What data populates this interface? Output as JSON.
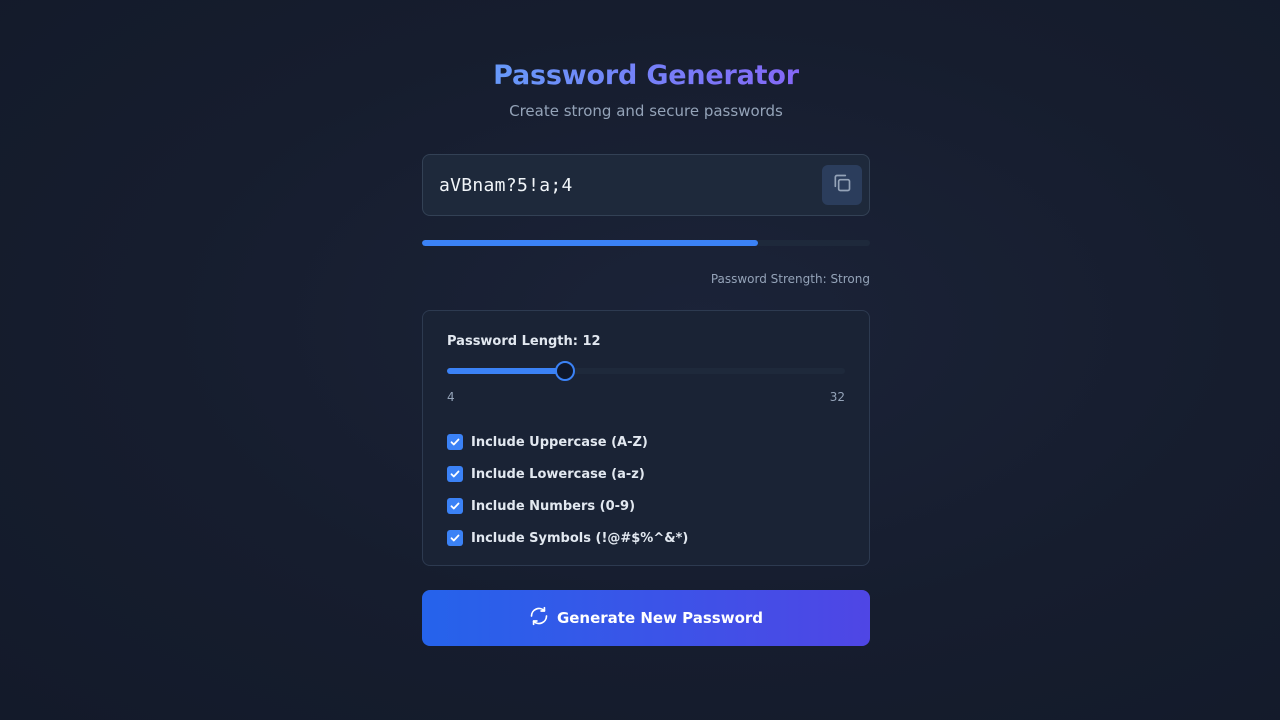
{
  "header": {
    "title": "Password Generator",
    "subtitle": "Create strong and secure passwords"
  },
  "password": {
    "value": "aVBnam?5!a;4",
    "copy_icon": "copy-icon"
  },
  "strength": {
    "level": 0.75,
    "label": "Password Strength: Strong",
    "color": "#3b82f6"
  },
  "options": {
    "length_label": "Password Length: 12",
    "length": {
      "value": 12,
      "min": 4,
      "max": 32,
      "min_label": "4",
      "max_label": "32"
    },
    "checkboxes": [
      {
        "label": "Include Uppercase (A-Z)",
        "checked": true
      },
      {
        "label": "Include Lowercase (a-z)",
        "checked": true
      },
      {
        "label": "Include Numbers (0-9)",
        "checked": true
      },
      {
        "label": "Include Symbols (!@#$%^&*)",
        "checked": true
      }
    ]
  },
  "generate": {
    "label": "Generate New Password",
    "icon": "refresh-icon"
  },
  "colors": {
    "accent": "#3b82f6",
    "gradient_start": "#2563eb",
    "gradient_end": "#4f46e5"
  }
}
